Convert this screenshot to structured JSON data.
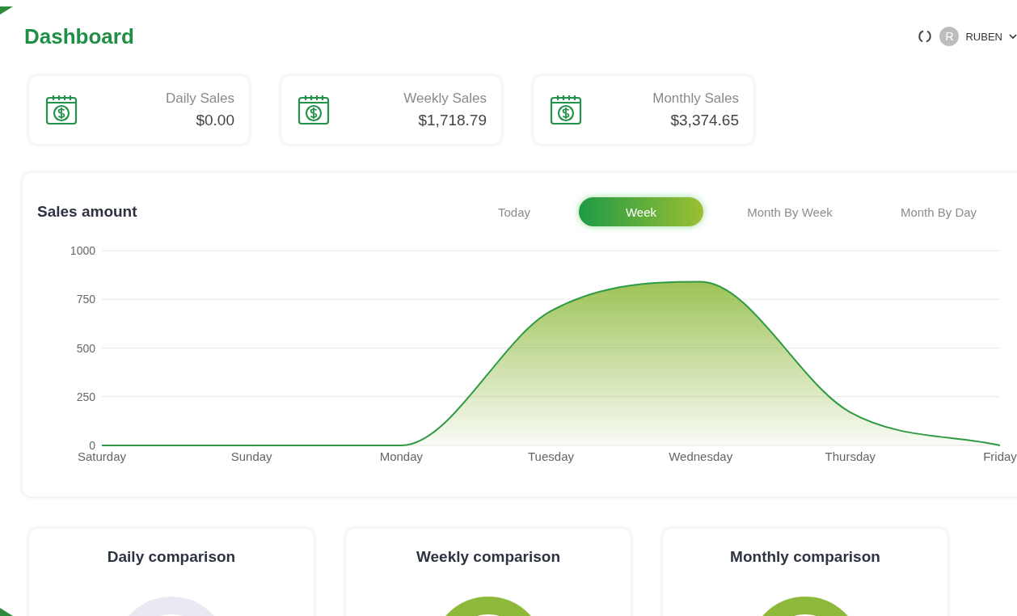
{
  "header": {
    "title": "Dashboard",
    "user": {
      "initial": "R",
      "name": "RUBEN"
    }
  },
  "stat_cards": [
    {
      "label": "Daily Sales",
      "value": "$0.00"
    },
    {
      "label": "Weekly Sales",
      "value": "$1,718.79"
    },
    {
      "label": "Monthly Sales",
      "value": "$3,374.65"
    }
  ],
  "sales_panel": {
    "title": "Sales amount",
    "tabs": [
      {
        "label": "Today",
        "selected": false
      },
      {
        "label": "Week",
        "selected": true
      },
      {
        "label": "Month By Week",
        "selected": false
      },
      {
        "label": "Month By Day",
        "selected": false
      }
    ],
    "chart_data": {
      "type": "area",
      "categories": [
        "Saturday",
        "Sunday",
        "Monday",
        "Tuesday",
        "Wednesday",
        "Thursday",
        "Friday"
      ],
      "series": [
        {
          "color": "#2e9a44",
          "values": [
            0,
            0,
            0,
            690,
            840,
            170,
            0
          ]
        }
      ],
      "ylim": [
        0,
        1000
      ],
      "yticks": [
        0,
        250,
        500,
        750,
        1000
      ],
      "grid": true
    }
  },
  "comparisons": [
    {
      "title": "Daily comparison",
      "color": "#e8e9f3"
    },
    {
      "title": "Weekly comparison",
      "color": "#8db83a"
    },
    {
      "title": "Monthly comparison",
      "color": "#8db83a"
    }
  ]
}
